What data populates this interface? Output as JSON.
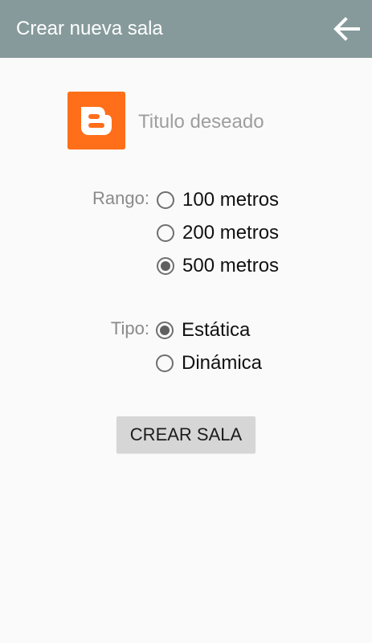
{
  "app_bar": {
    "title": "Crear nueva sala",
    "back_icon": "arrow-left-icon",
    "background": "#869a9b"
  },
  "room_form": {
    "logo_icon": "blogger-icon",
    "logo_color": "#ff6f1a",
    "title_field": {
      "value": "",
      "placeholder": "Titulo deseado"
    },
    "range": {
      "label": "Rango:",
      "options": [
        {
          "label": "100 metros",
          "selected": false
        },
        {
          "label": "200 metros",
          "selected": false
        },
        {
          "label": "500 metros",
          "selected": true
        }
      ]
    },
    "type": {
      "label": "Tipo:",
      "options": [
        {
          "label": "Estática",
          "selected": true
        },
        {
          "label": "Dinámica",
          "selected": false
        }
      ]
    },
    "create_button_label": "CREAR SALA"
  }
}
